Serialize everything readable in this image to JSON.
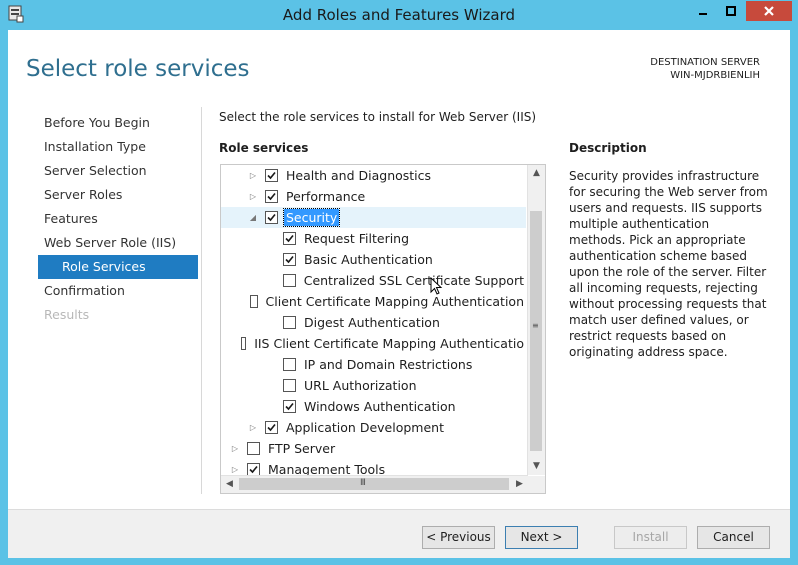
{
  "window": {
    "title": "Add Roles and Features Wizard",
    "minimize_glyph": "▁",
    "maximize_glyph": "□",
    "close_glyph": "✕"
  },
  "header": {
    "page_title": "Select role services",
    "destination_label": "DESTINATION SERVER",
    "destination_server": "WIN-MJDRBIENLIH"
  },
  "nav": {
    "items": [
      {
        "label": "Before You Begin",
        "state": "normal"
      },
      {
        "label": "Installation Type",
        "state": "normal"
      },
      {
        "label": "Server Selection",
        "state": "normal"
      },
      {
        "label": "Server Roles",
        "state": "normal"
      },
      {
        "label": "Features",
        "state": "normal"
      },
      {
        "label": "Web Server Role (IIS)",
        "state": "normal"
      },
      {
        "label": "Role Services",
        "state": "active"
      },
      {
        "label": "Confirmation",
        "state": "normal"
      },
      {
        "label": "Results",
        "state": "disabled"
      }
    ]
  },
  "main": {
    "instruction": "Select the role services to install for Web Server (IIS)",
    "role_services_heading": "Role services",
    "description_heading": "Description",
    "description_text": "Security provides infrastructure for securing the Web server from users and requests. IIS supports multiple authentication methods. Pick an appropriate authentication scheme based upon the role of the server. Filter all incoming requests, rejecting without processing requests that match user defined values, or restrict requests based on originating address space."
  },
  "tree": {
    "rows": [
      {
        "label": "Health and Diagnostics",
        "level": 1,
        "expander": "collapsed",
        "checked": true,
        "selected": false
      },
      {
        "label": "Performance",
        "level": 1,
        "expander": "collapsed",
        "checked": true,
        "selected": false
      },
      {
        "label": "Security",
        "level": 1,
        "expander": "expanded",
        "checked": true,
        "selected": true
      },
      {
        "label": "Request Filtering",
        "level": 2,
        "expander": "none",
        "checked": true,
        "selected": false
      },
      {
        "label": "Basic Authentication",
        "level": 2,
        "expander": "none",
        "checked": true,
        "selected": false
      },
      {
        "label": "Centralized SSL Certificate Support",
        "level": 2,
        "expander": "none",
        "checked": false,
        "selected": false
      },
      {
        "label": "Client Certificate Mapping Authentication",
        "level": 2,
        "expander": "none",
        "checked": false,
        "selected": false
      },
      {
        "label": "Digest Authentication",
        "level": 2,
        "expander": "none",
        "checked": false,
        "selected": false
      },
      {
        "label": "IIS Client Certificate Mapping Authenticatio",
        "level": 2,
        "expander": "none",
        "checked": false,
        "selected": false
      },
      {
        "label": "IP and Domain Restrictions",
        "level": 2,
        "expander": "none",
        "checked": false,
        "selected": false
      },
      {
        "label": "URL Authorization",
        "level": 2,
        "expander": "none",
        "checked": false,
        "selected": false
      },
      {
        "label": "Windows Authentication",
        "level": 2,
        "expander": "none",
        "checked": true,
        "selected": false
      },
      {
        "label": "Application Development",
        "level": 1,
        "expander": "collapsed",
        "checked": true,
        "selected": false
      },
      {
        "label": "FTP Server",
        "level": 0,
        "expander": "collapsed",
        "checked": false,
        "selected": false
      },
      {
        "label": "Management Tools",
        "level": 0,
        "expander": "collapsed",
        "checked": true,
        "selected": false
      }
    ],
    "scroll_up_glyph": "▲",
    "scroll_down_glyph": "▼",
    "scroll_left_glyph": "◀",
    "scroll_right_glyph": "▶",
    "grip_glyph": "III"
  },
  "footer": {
    "previous_label": "< Previous",
    "next_label": "Next >",
    "install_label": "Install",
    "cancel_label": "Cancel"
  }
}
